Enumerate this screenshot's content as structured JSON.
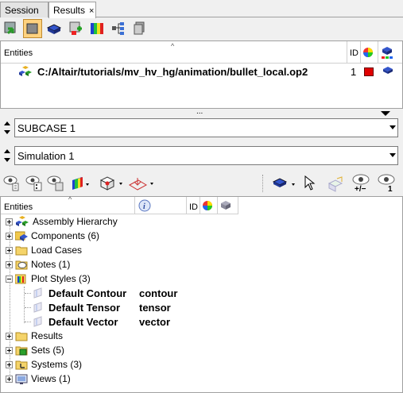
{
  "tabs": [
    {
      "label": "Session"
    },
    {
      "label": "Results",
      "close": "×"
    }
  ],
  "top_table": {
    "headers": {
      "entities": "Entities",
      "id": "ID"
    },
    "row": {
      "path": "C:/Altair/tutorials/mv_hv_hg/animation/bullet_local.op2",
      "id": "1",
      "color": "#e00000"
    }
  },
  "splitter_grip": "...",
  "subcase_select": {
    "value": "SUBCASE 1"
  },
  "simulation_select": {
    "value": "Simulation 1"
  },
  "toolbar2": {
    "plus_minus": "+/−",
    "one": "1"
  },
  "bottom_table": {
    "headers": {
      "entities": "Entities",
      "id": "ID"
    },
    "rows": [
      {
        "label": "Assembly Hierarchy",
        "icon": "assembly-icon"
      },
      {
        "label": "Components (6)",
        "icon": "components-icon"
      },
      {
        "label": "Load Cases",
        "icon": "folder-icon"
      },
      {
        "label": "Notes (1)",
        "icon": "notes-icon"
      },
      {
        "label": "Plot Styles (3)",
        "icon": "plot-styles-icon"
      },
      {
        "label": "Default Contour",
        "type": "contour"
      },
      {
        "label": "Default Tensor",
        "type": "tensor"
      },
      {
        "label": "Default Vector",
        "type": "vector"
      },
      {
        "label": "Results",
        "icon": "folder-icon"
      },
      {
        "label": "Sets  (5)",
        "icon": "sets-icon"
      },
      {
        "label": "Systems (3)",
        "icon": "systems-icon"
      },
      {
        "label": "Views (1)",
        "icon": "views-icon"
      }
    ]
  },
  "colors": {
    "accent_orange": "#ffd27f",
    "selection_blue": "#1e5bd6",
    "red": "#e00000"
  }
}
